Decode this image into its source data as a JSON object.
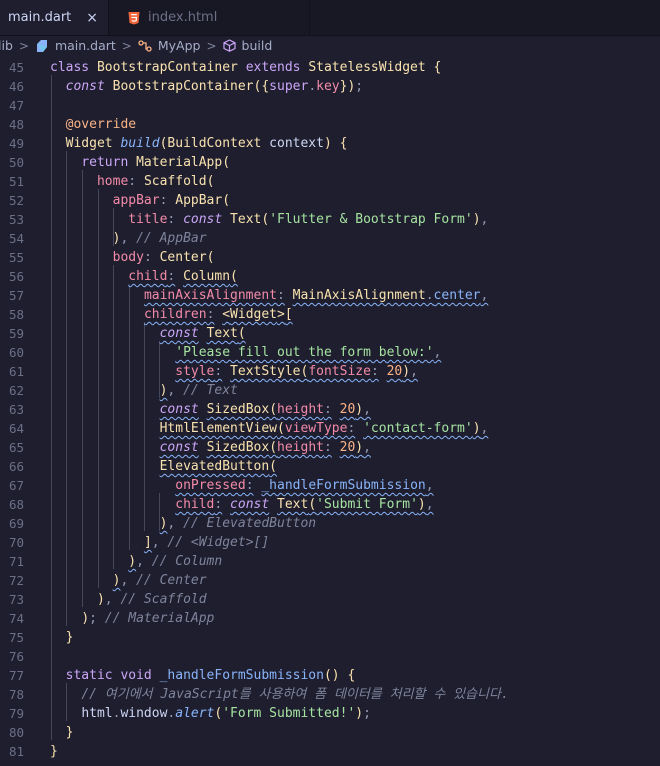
{
  "tabs": [
    {
      "label": "main.dart",
      "active": true,
      "icon": "dart-icon",
      "close": "×"
    },
    {
      "label": "index.html",
      "active": false,
      "icon": "html5-icon"
    }
  ],
  "breadcrumb": {
    "folder": "lib",
    "file": "main.dart",
    "class": "MyApp",
    "method": "build",
    "separator": ">"
  },
  "colors": {
    "background": "#1e1e2e",
    "keyword": "#cba6f7",
    "type": "#f9e2af",
    "function": "#89b4fa",
    "string": "#a6e3a1",
    "number": "#fab387",
    "comment": "#7f849c"
  },
  "editor": {
    "line_numbers": [
      "45",
      "46",
      "47",
      "48",
      "49",
      "50",
      "51",
      "52",
      "53",
      "54",
      "55",
      "56",
      "57",
      "58",
      "59",
      "60",
      "61",
      "62",
      "63",
      "64",
      "65",
      "66",
      "67",
      "68",
      "69",
      "70",
      "71",
      "72",
      "73",
      "74",
      "75",
      "76",
      "77",
      "78",
      "79",
      "80",
      "81"
    ],
    "lines": [
      "class BootstrapContainer extends StatelessWidget {",
      "  const BootstrapContainer({super.key});",
      "",
      "  @override",
      "  Widget build(BuildContext context) {",
      "    return MaterialApp(",
      "      home: Scaffold(",
      "        appBar: AppBar(",
      "          title: const Text('Flutter & Bootstrap Form'),",
      "        ), // AppBar",
      "        body: Center(",
      "          child: Column(",
      "            mainAxisAlignment: MainAxisAlignment.center,",
      "            children: <Widget>[",
      "              const Text(",
      "                'Please fill out the form below:',",
      "                style: TextStyle(fontSize: 20),",
      "              ), // Text",
      "              const SizedBox(height: 20),",
      "              HtmlElementView(viewType: 'contact-form'),",
      "              const SizedBox(height: 20),",
      "              ElevatedButton(",
      "                onPressed: _handleFormSubmission,",
      "                child: const Text('Submit Form'),",
      "              ), // ElevatedButton",
      "            ], // <Widget>[]",
      "          ), // Column",
      "        ), // Center",
      "      ), // Scaffold",
      "    ); // MaterialApp",
      "  }",
      "",
      "  static void _handleFormSubmission() {",
      "    // 여기에서 JavaScript를 사용하여 폼 데이터를 처리할 수 있습니다.",
      "    html.window.alert('Form Submitted!');",
      "  }",
      "}"
    ]
  }
}
